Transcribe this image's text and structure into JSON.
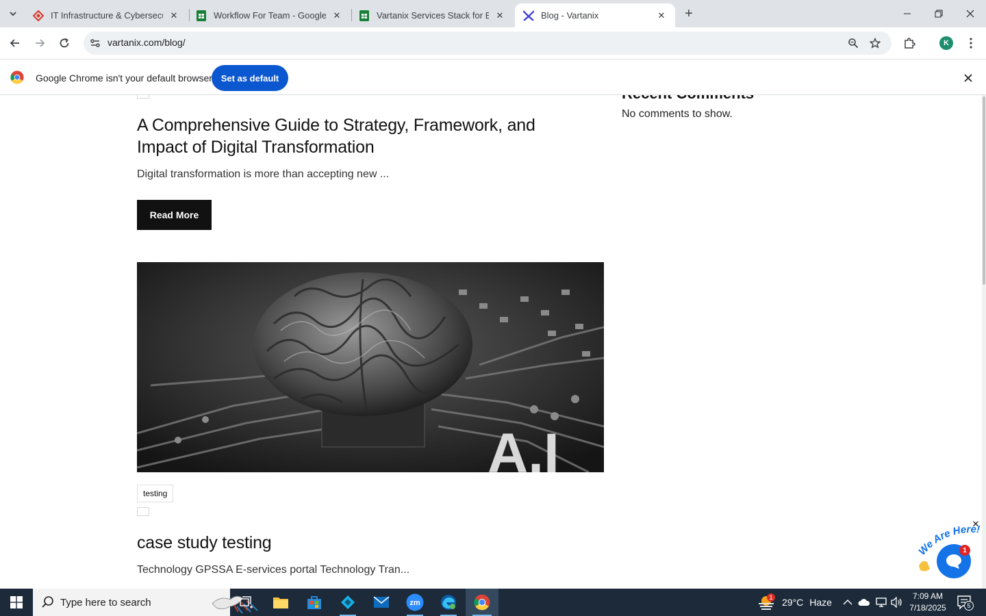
{
  "browser": {
    "tabs": [
      {
        "title": "IT Infrastructure & Cybersecurit",
        "active": false
      },
      {
        "title": "Workflow For Team - Google Sh",
        "active": false
      },
      {
        "title": "Vartanix Services Stack for Blog",
        "active": false
      },
      {
        "title": "Blog - Vartanix",
        "active": true
      }
    ],
    "url": "vartanix.com/blog/",
    "profile_initial": "K"
  },
  "infobar": {
    "message": "Google Chrome isn't your default browser",
    "button_label": "Set as default"
  },
  "page": {
    "sidebar": {
      "heading": "Recent Comments",
      "empty_text": "No comments to show."
    },
    "posts": [
      {
        "title_line1": "A Comprehensive Guide to Strategy, Framework, and",
        "title_line2": "Impact of Digital Transformation",
        "excerpt": "Digital transformation is more than accepting new ...",
        "read_more": "Read More"
      },
      {
        "image_text": "A.I",
        "tag": "testing",
        "title": "case study testing",
        "excerpt": "Technology GPSSA E-services portal Technology Tran..."
      }
    ],
    "chat_widget": {
      "banner": "We Are Here!",
      "badge_count": "1"
    }
  },
  "taskbar": {
    "search_placeholder": "Type here to search",
    "weather": {
      "badge": "1",
      "temp": "29°C",
      "condition": "Haze"
    },
    "time": "7:09 AM",
    "date": "7/18/2025",
    "notification_count": "5"
  },
  "colors": {
    "tabstrip": "#dfe3e8",
    "accent_button": "#0b57d0",
    "read_more_bg": "#111111",
    "chat_bubble": "#1473e6",
    "taskbar": "#1c2a3a"
  }
}
